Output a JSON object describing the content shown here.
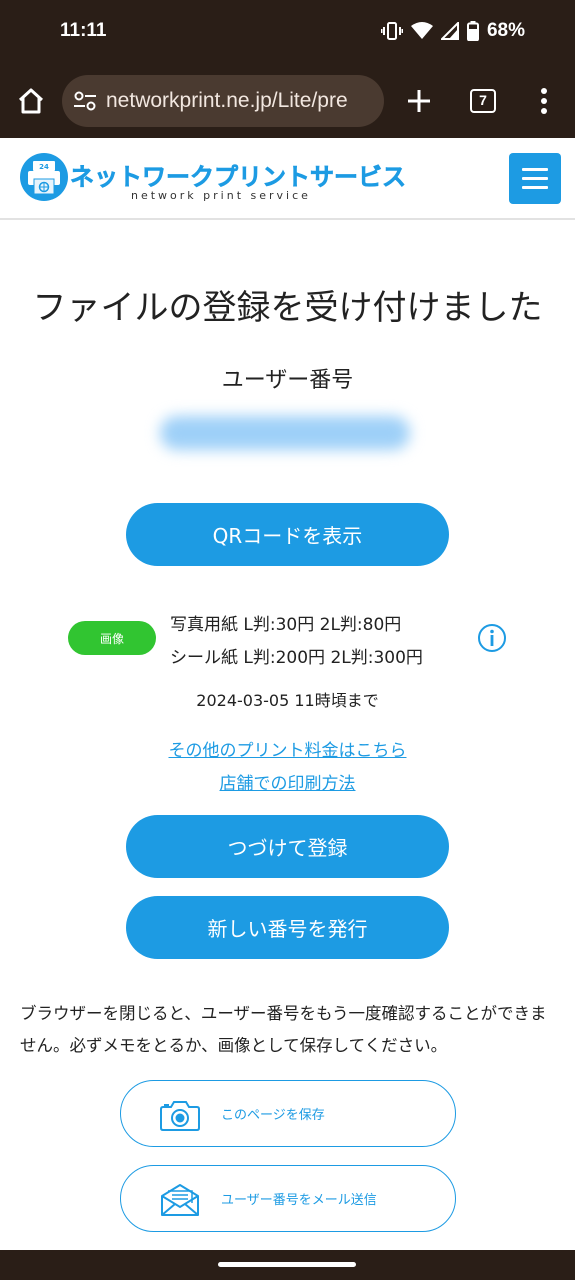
{
  "status_bar": {
    "time": "11:11",
    "battery": "68%"
  },
  "browser": {
    "url": "networkprint.ne.jp/Lite/pre",
    "tab_count": "7"
  },
  "header": {
    "logo_badge": "24",
    "logo_title": "ネットワークプリントサービス",
    "logo_subtitle": "network print service"
  },
  "main": {
    "title": "ファイルの登録を受け付けました",
    "user_number_label": "ユーザー番号",
    "qr_button": "QRコードを表示",
    "badge": "画像",
    "price_lines": [
      "写真用紙 L判:30円 2L判:80円",
      "シール紙 L判:200円 2L判:300円"
    ],
    "deadline": "2024-03-05 11時頃まで",
    "links": [
      "その他のプリント料金はこちら",
      "店舗での印刷方法"
    ],
    "continue_button": "つづけて登録",
    "new_number_button": "新しい番号を発行",
    "note": "ブラウザーを閉じると、ユーザー番号をもう一度確認することができません。必ずメモをとるか、画像として保存してください。",
    "save_page_button": "このページを保存",
    "email_button": "ユーザー番号をメール送信"
  },
  "colors": {
    "accent": "#1d9be3",
    "badge_green": "#31c531",
    "chrome_bg": "#2a1e17"
  }
}
